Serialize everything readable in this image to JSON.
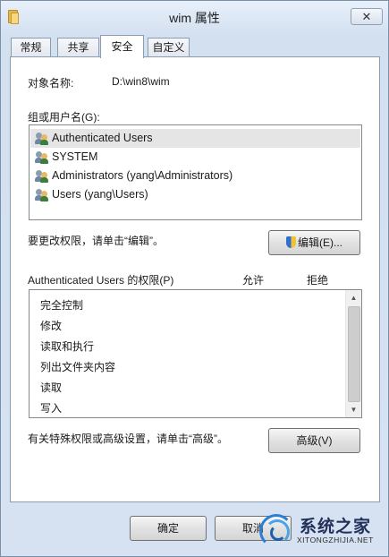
{
  "window": {
    "title": "wim 属性",
    "close_glyph": "✕"
  },
  "tabs": [
    {
      "label": "常规",
      "active": false
    },
    {
      "label": "共享",
      "active": false
    },
    {
      "label": "安全",
      "active": true
    },
    {
      "label": "自定义",
      "active": false
    }
  ],
  "object": {
    "label": "对象名称:",
    "value": "D:\\win8\\wim"
  },
  "groups": {
    "label": "组或用户名(G):",
    "items": [
      {
        "name": "Authenticated Users",
        "selected": true
      },
      {
        "name": "SYSTEM",
        "selected": false
      },
      {
        "name": "Administrators (yang\\Administrators)",
        "selected": false
      },
      {
        "name": "Users (yang\\Users)",
        "selected": false
      }
    ],
    "icon": "users-group-icon"
  },
  "edit_hint": "要更改权限，请单击“编辑”。",
  "edit_button": {
    "label": "编辑(E)...",
    "icon": "uac-shield-icon"
  },
  "permissions": {
    "header": "Authenticated Users 的权限(P)",
    "allow": "允许",
    "deny": "拒绝",
    "items": [
      "完全控制",
      "修改",
      "读取和执行",
      "列出文件夹内容",
      "读取",
      "写入"
    ]
  },
  "advanced_hint": "有关特殊权限或高级设置，请单击“高级”。",
  "advanced_button": {
    "label": "高级(V)"
  },
  "footer": {
    "ok": "确定",
    "cancel": "取消"
  },
  "watermark": {
    "name": "系统之家",
    "url": "XITONGZHIJIA.NET"
  },
  "colors": {
    "accent": "#2f6fd0",
    "chrome": "#d6e2f1",
    "selection": "#e5e5e5"
  }
}
